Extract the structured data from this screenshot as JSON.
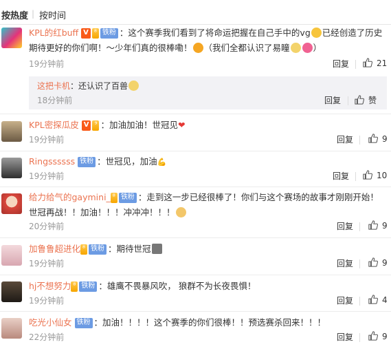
{
  "sort": {
    "hot": "按热度",
    "time": "按时间"
  },
  "ui": {
    "reply": "回复",
    "like": "赞"
  },
  "comments": [
    {
      "user": "KPL的红buff",
      "badge_level": "铁粉",
      "text_a": "：这个赛季我们看到了将命运把握在自己手中的vg",
      "text_b": "已经创造了历史 期待更好的你们啊！～少年们真的很棒嘞！",
      "text_c": "（我们全都认识了易瞳",
      "text_d": "）",
      "time": "19分钟前",
      "likes": "21",
      "sub": {
        "user": "这把卡机",
        "text": "：还认识了百兽",
        "time": "18分钟前"
      }
    },
    {
      "user": "KPL密探瓜皮",
      "text": "：加油加油！世冠见",
      "time": "19分钟前",
      "likes": "9"
    },
    {
      "user": "Ringssssss",
      "badge_level": "铁粉",
      "text": "：世冠见，加油",
      "time": "19分钟前",
      "likes": "10"
    },
    {
      "user": "给力给气的gaymini_",
      "badge_level": "铁粉",
      "text_a": "：走到这一步已经很棒了！你们与这个赛场的故事才刚刚开始！世冠再战！！加油！！！冲冲冲！！！",
      "time": "20分钟前",
      "likes": "9"
    },
    {
      "user": "加鲁鲁超进化",
      "badge_level": "铁粉",
      "text": "：期待世冠",
      "time": "19分钟前",
      "likes": "9"
    },
    {
      "user": "hj不想努力",
      "badge_level": "铁粉",
      "text": "：雄鹰不畏暴风吹， 狼群不为长夜畏惧！",
      "time": "19分钟前",
      "likes": "4"
    },
    {
      "user": "吃光小仙女",
      "badge_level": "铁粉",
      "text": "：加油！！！！这个赛季的你们很棒！！预选赛杀回来！！！",
      "time": "22分钟前",
      "likes": "9"
    }
  ],
  "colors": {
    "name": "#eb7350",
    "fan_badge": "#6c9be3",
    "vip": "#f95a19"
  }
}
